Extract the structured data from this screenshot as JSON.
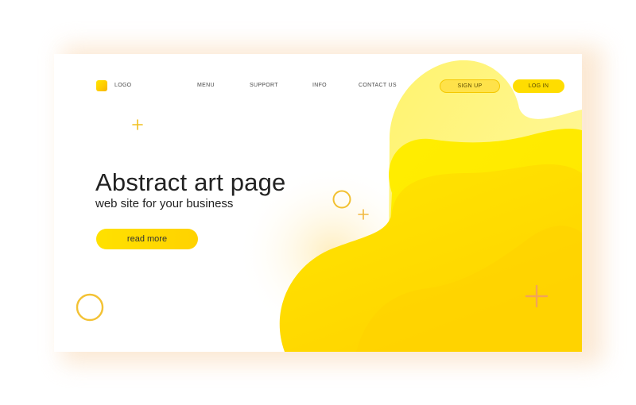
{
  "nav": {
    "logo_label": "LOGO",
    "menu": "MENU",
    "support": "SUPPORT",
    "info": "INFO",
    "contact": "CONTACT US",
    "signup": "SIGN UP",
    "login": "LOG IN"
  },
  "hero": {
    "title": "Abstract art page",
    "subtitle": "web site for your business",
    "cta": "read more"
  },
  "colors": {
    "accent": "#ffdd00",
    "accent_light": "#fff27a",
    "decor_orange": "#f2a45a",
    "text": "#222222"
  },
  "decorations": [
    "plus-icon",
    "circle-ring-icon",
    "plus-icon",
    "circle-ring-icon",
    "plus-icon"
  ]
}
